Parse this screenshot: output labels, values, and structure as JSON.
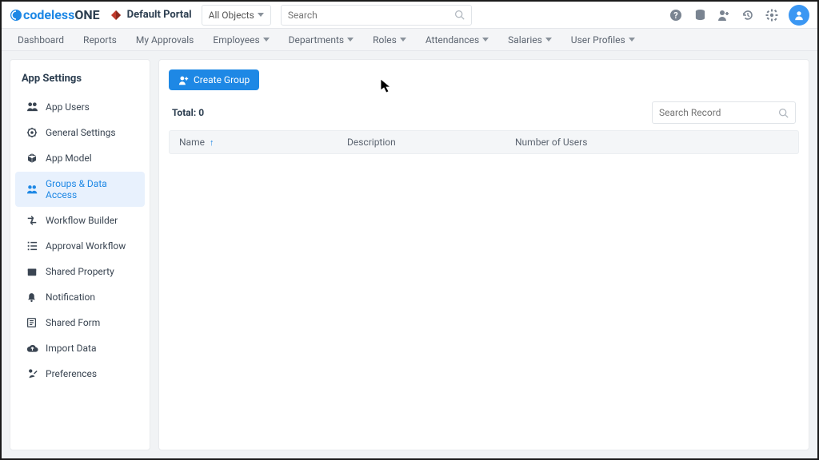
{
  "brand": {
    "part1": "codeless",
    "part2": "ONE"
  },
  "portal": {
    "name": "Default Portal"
  },
  "objectFilter": {
    "label": "All Objects"
  },
  "search": {
    "placeholder": "Search"
  },
  "nav": [
    {
      "label": "Dashboard",
      "dropdown": false
    },
    {
      "label": "Reports",
      "dropdown": false
    },
    {
      "label": "My Approvals",
      "dropdown": false
    },
    {
      "label": "Employees",
      "dropdown": true
    },
    {
      "label": "Departments",
      "dropdown": true
    },
    {
      "label": "Roles",
      "dropdown": true
    },
    {
      "label": "Attendances",
      "dropdown": true
    },
    {
      "label": "Salaries",
      "dropdown": true
    },
    {
      "label": "User Profiles",
      "dropdown": true
    }
  ],
  "sidebar": {
    "title": "App Settings",
    "items": [
      {
        "label": "App Users",
        "icon": "users"
      },
      {
        "label": "General Settings",
        "icon": "gear"
      },
      {
        "label": "App Model",
        "icon": "cube"
      },
      {
        "label": "Groups & Data Access",
        "icon": "users-gear",
        "active": true
      },
      {
        "label": "Workflow Builder",
        "icon": "flow"
      },
      {
        "label": "Approval Workflow",
        "icon": "checklist"
      },
      {
        "label": "Shared Property",
        "icon": "package"
      },
      {
        "label": "Notification",
        "icon": "bell"
      },
      {
        "label": "Shared Form",
        "icon": "form"
      },
      {
        "label": "Import Data",
        "icon": "cloud-up"
      },
      {
        "label": "Preferences",
        "icon": "pref"
      }
    ]
  },
  "content": {
    "createButton": "Create Group",
    "totalPrefix": "Total: ",
    "totalCount": "0",
    "searchPlaceholder": "Search Record",
    "columns": {
      "name": "Name",
      "description": "Description",
      "users": "Number of Users"
    }
  }
}
